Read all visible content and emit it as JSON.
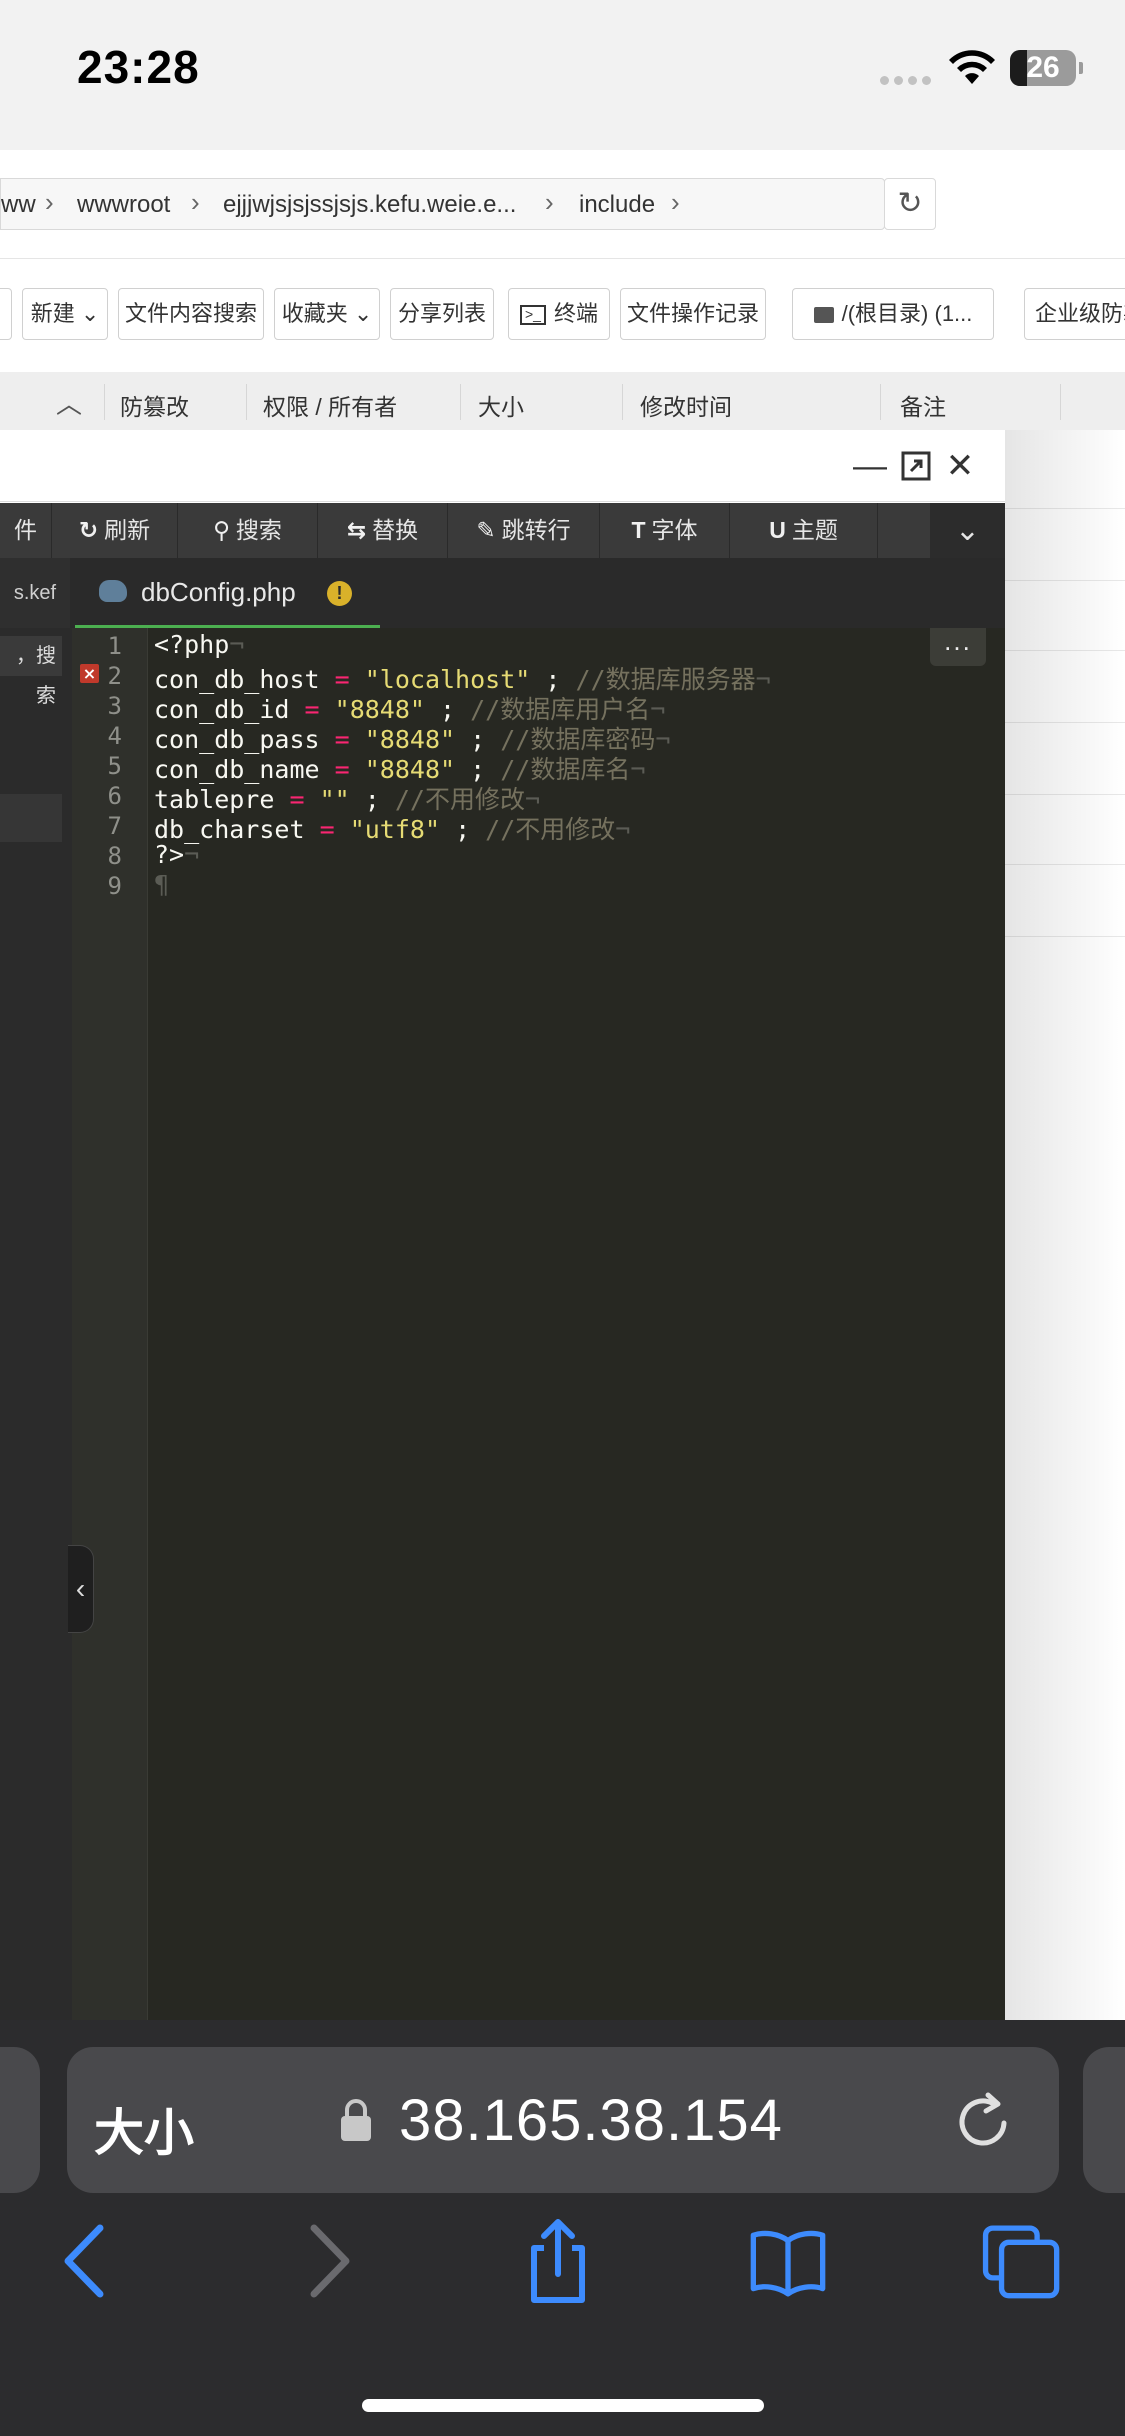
{
  "status_bar": {
    "time": "23:28",
    "battery": "26"
  },
  "breadcrumb": {
    "items": [
      "ww",
      "wwwroot",
      "ejjjwjsjsjssjsjs.kefu.weie.e...",
      "include"
    ]
  },
  "toolbar": {
    "new": "新建",
    "file_search": "文件内容搜索",
    "favorites": "收藏夹",
    "share_list": "分享列表",
    "terminal": "终端",
    "file_log": "文件操作记录",
    "root_dir": "/(根目录) (1...",
    "enterprise": "企业级防篡"
  },
  "table_header": {
    "tamper": "防篡改",
    "permission": "权限 / 所有者",
    "size": "大小",
    "mtime": "修改时间",
    "note": "备注"
  },
  "editor": {
    "toolbar": {
      "file": "件",
      "refresh": "刷新",
      "search": "搜索",
      "replace": "替换",
      "goto_line": "跳转行",
      "font": "字体",
      "theme": "主题"
    },
    "left_tab": "s.kef",
    "active_tab": "dbConfig.php",
    "sidebar_search": "，搜索",
    "lines": [
      {
        "n": "1",
        "code": "<?php",
        "error": false
      },
      {
        "n": "2",
        "code": "con_db_host = \"localhost\" ; //数据库服务器",
        "error": true
      },
      {
        "n": "3",
        "code": "con_db_id = \"8848\" ; //数据库用户名",
        "error": false
      },
      {
        "n": "4",
        "code": "con_db_pass = \"8848\" ; //数据库密码",
        "error": false
      },
      {
        "n": "5",
        "code": "con_db_name = \"8848\" ; //数据库名",
        "error": false
      },
      {
        "n": "6",
        "code": "tablepre = \"\" ; //不用修改",
        "error": false
      },
      {
        "n": "7",
        "code": "db_charset = \"utf8\" ; //不用修改",
        "error": false
      },
      {
        "n": "8",
        "code": "?>",
        "error": false
      },
      {
        "n": "9",
        "code": "",
        "error": false
      }
    ]
  },
  "safari": {
    "text_size": "大小",
    "url": "38.165.38.154"
  },
  "colors": {
    "editor_bg": "#272822",
    "keyword_pink": "#f92672",
    "string_yellow": "#e6db74",
    "comment_gray": "#75715e",
    "ios_blue": "#3d8bfd"
  }
}
